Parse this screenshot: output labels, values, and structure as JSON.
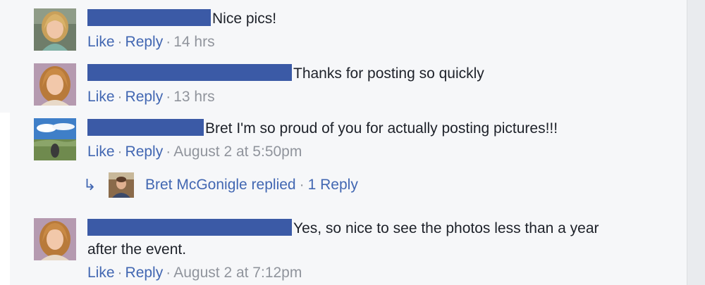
{
  "comments": [
    {
      "avatar_icon": "profile-photo-blonde-woman",
      "text": "Nice pics!",
      "continuation": "",
      "like_label": "Like",
      "reply_label": "Reply",
      "timestamp": "14 hrs"
    },
    {
      "avatar_icon": "profile-photo-woman-long-hair",
      "text": "Thanks for posting so quickly",
      "continuation": "",
      "like_label": "Like",
      "reply_label": "Reply",
      "timestamp": "13 hrs"
    },
    {
      "avatar_icon": "profile-photo-landscape-sky",
      "text": "Bret I'm so proud of you for actually posting pictures!!!",
      "continuation": "",
      "like_label": "Like",
      "reply_label": "Reply",
      "timestamp": "August 2 at 5:50pm"
    },
    {
      "avatar_icon": "profile-photo-woman-long-hair",
      "text": "Yes, so nice to see the photos less than a year",
      "continuation": "after the event.",
      "like_label": "Like",
      "reply_label": "Reply",
      "timestamp": "August 2 at 7:12pm"
    }
  ],
  "reply_summary": {
    "arrow_icon": "reply-arrow-icon",
    "avatar_icon": "profile-photo-man",
    "text": "Bret McGonigle replied",
    "count": "1 Reply"
  },
  "separator": "·",
  "colors": {
    "redaction": "#3b5aa6",
    "link": "#4267b2",
    "meta": "#90949c",
    "text": "#1d2129",
    "background": "#f6f7f9"
  }
}
